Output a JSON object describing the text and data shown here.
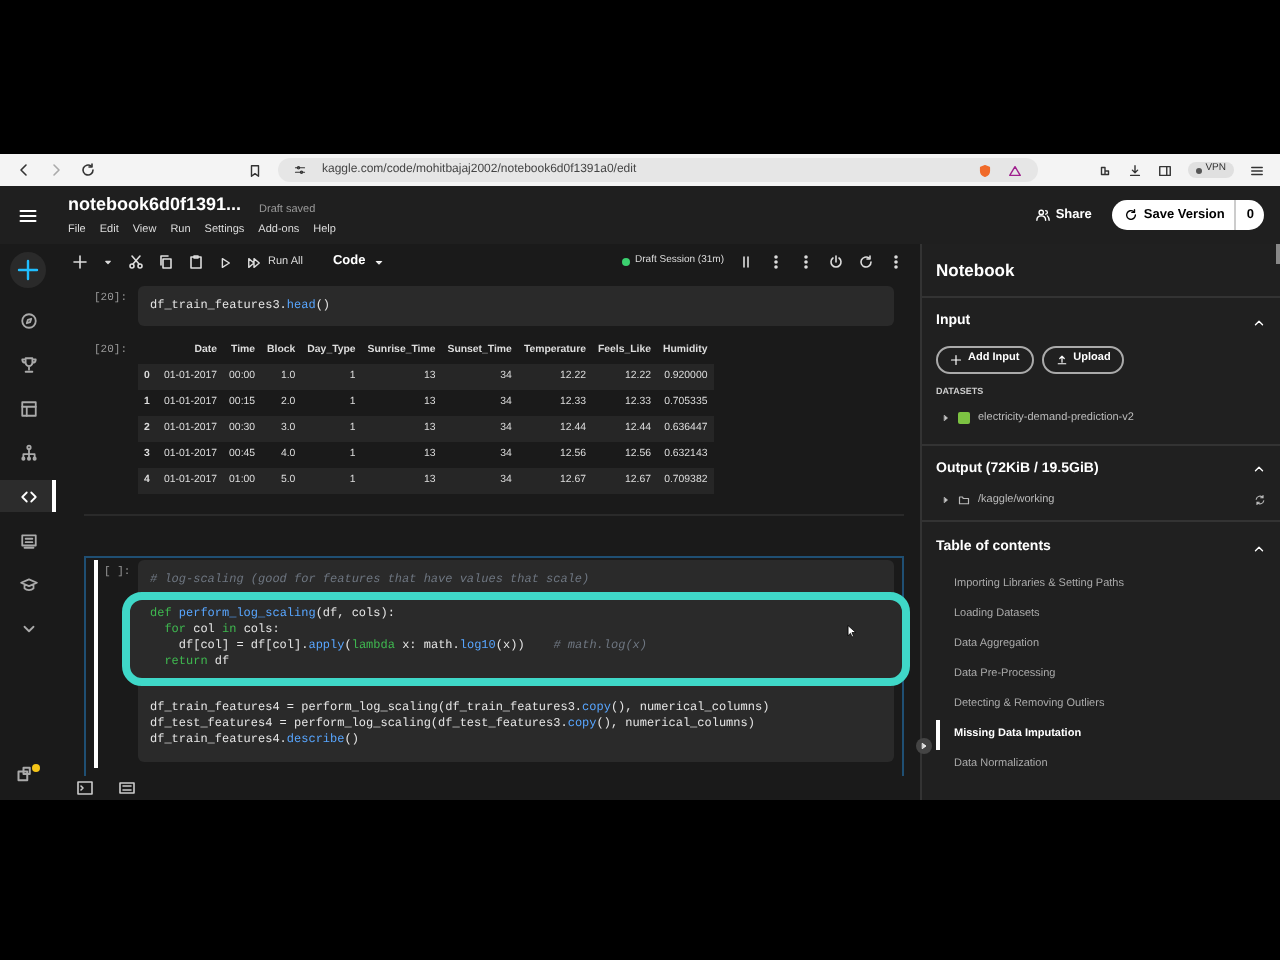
{
  "browser": {
    "url": "kaggle.com/code/mohitbajaj2002/notebook6d0f1391a0/edit",
    "vpn": "VPN"
  },
  "header": {
    "title": "notebook6d0f1391...",
    "save_status": "Draft saved",
    "menu": [
      "File",
      "Edit",
      "View",
      "Run",
      "Settings",
      "Add-ons",
      "Help"
    ],
    "share": "Share",
    "save_version": "Save Version",
    "version_count": "0"
  },
  "sidebar": {
    "items": [
      {
        "kind": "compass",
        "selected": false
      },
      {
        "kind": "trophy",
        "selected": false
      },
      {
        "kind": "table",
        "selected": false
      },
      {
        "kind": "tree",
        "selected": false
      },
      {
        "kind": "code",
        "selected": true
      },
      {
        "kind": "list",
        "selected": false
      },
      {
        "kind": "cap",
        "selected": false
      },
      {
        "kind": "chevron",
        "selected": false
      }
    ]
  },
  "toolbar": {
    "run_all": "Run All",
    "cell_type": "Code",
    "session": "Draft Session (31m)"
  },
  "cells": [
    {
      "kind": "code",
      "prompt": "[20]:",
      "selected": false,
      "lines": [
        [
          {
            "text": "df_train_features3.",
            "kind": "plain"
          },
          {
            "text": "head",
            "kind": "method"
          },
          {
            "text": "()",
            "kind": "plain"
          }
        ]
      ]
    },
    {
      "kind": "table",
      "prompt": "[20]:",
      "columns": [
        "Date",
        "Time",
        "Block",
        "Day_Type",
        "Sunrise_Time",
        "Sunset_Time",
        "Temperature",
        "Feels_Like",
        "Humidity"
      ],
      "rows": [
        {
          "index": "0",
          "cells": [
            "01-01-2017",
            "00:00",
            "1.0",
            "1",
            "13",
            "34",
            "12.22",
            "12.22",
            "0.920000"
          ]
        },
        {
          "index": "1",
          "cells": [
            "01-01-2017",
            "00:15",
            "2.0",
            "1",
            "13",
            "34",
            "12.33",
            "12.33",
            "0.705335"
          ]
        },
        {
          "index": "2",
          "cells": [
            "01-01-2017",
            "00:30",
            "3.0",
            "1",
            "13",
            "34",
            "12.44",
            "12.44",
            "0.636447"
          ]
        },
        {
          "index": "3",
          "cells": [
            "01-01-2017",
            "00:45",
            "4.0",
            "1",
            "13",
            "34",
            "12.56",
            "12.56",
            "0.632143"
          ]
        },
        {
          "index": "4",
          "cells": [
            "01-01-2017",
            "01:00",
            "5.0",
            "1",
            "13",
            "34",
            "12.67",
            "12.67",
            "0.709382"
          ]
        }
      ]
    },
    {
      "kind": "code",
      "prompt": "[ ]:",
      "selected": true,
      "lines": [
        [
          {
            "text": "# log-scaling (good for features that have values that scale)",
            "kind": "comment"
          }
        ],
        [
          {
            "text": "def ",
            "kind": "keyword"
          },
          {
            "text": "perform_log_scaling",
            "kind": "func"
          },
          {
            "text": "(df, cols):",
            "kind": "plain"
          }
        ],
        [
          {
            "text": "  for ",
            "kind": "keyword"
          },
          {
            "text": "col ",
            "kind": "plain"
          },
          {
            "text": "in ",
            "kind": "keyword"
          },
          {
            "text": "cols:",
            "kind": "plain"
          }
        ],
        [
          {
            "text": "    df[col] = df[col].",
            "kind": "plain"
          },
          {
            "text": "apply",
            "kind": "method"
          },
          {
            "text": "(",
            "kind": "plain"
          },
          {
            "text": "lambda ",
            "kind": "keyword"
          },
          {
            "text": "x: math.",
            "kind": "plain"
          },
          {
            "text": "log10",
            "kind": "method"
          },
          {
            "text": "(x))    ",
            "kind": "plain"
          },
          {
            "text": "# math.log(x)",
            "kind": "comment"
          }
        ],
        [
          {
            "text": "  return ",
            "kind": "keyword"
          },
          {
            "text": "df",
            "kind": "plain"
          }
        ],
        [
          {
            "text": "df_train_features4 = perform_log_scaling(df_train_features3.",
            "kind": "plain"
          },
          {
            "text": "copy",
            "kind": "method"
          },
          {
            "text": "(), numerical_columns)",
            "kind": "plain"
          }
        ],
        [
          {
            "text": "df_test_features4 = perform_log_scaling(df_test_features3.",
            "kind": "plain"
          },
          {
            "text": "copy",
            "kind": "method"
          },
          {
            "text": "(), numerical_columns)",
            "kind": "plain"
          }
        ],
        [
          {
            "text": "df_train_features4.",
            "kind": "plain"
          },
          {
            "text": "describe",
            "kind": "method"
          },
          {
            "text": "()",
            "kind": "plain"
          }
        ]
      ]
    }
  ],
  "panel": {
    "title": "Notebook",
    "input": {
      "heading": "Input",
      "add_input": "Add Input",
      "upload": "Upload",
      "datasets_label": "DATASETS",
      "dataset": "electricity-demand-prediction-v2"
    },
    "output": {
      "heading": "Output (72KiB / 19.5GiB)",
      "folder": "/kaggle/working"
    },
    "toc": {
      "heading": "Table of contents",
      "items": [
        {
          "label": "Importing Libraries & Setting Paths",
          "selected": false
        },
        {
          "label": "Loading Datasets",
          "selected": false
        },
        {
          "label": "Data Aggregation",
          "selected": false
        },
        {
          "label": "Data Pre-Processing",
          "selected": false
        },
        {
          "label": "Detecting & Removing Outliers",
          "selected": false
        },
        {
          "label": "Missing Data Imputation",
          "selected": true
        },
        {
          "label": "Data Normalization",
          "selected": false
        }
      ]
    }
  }
}
